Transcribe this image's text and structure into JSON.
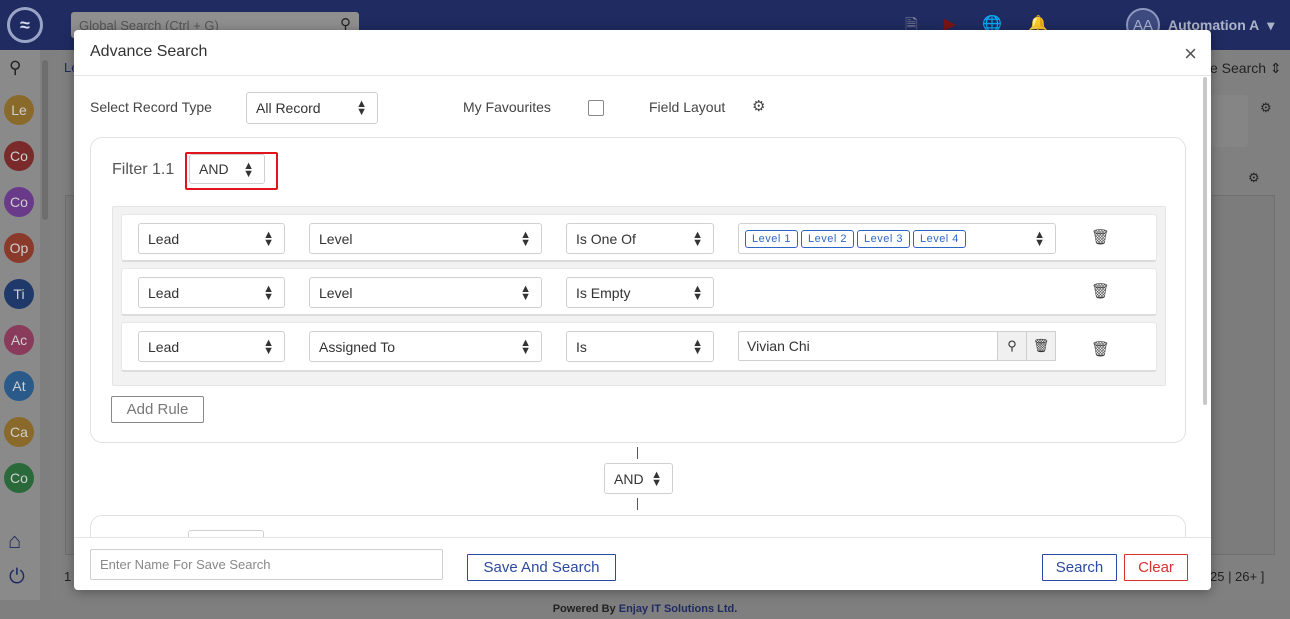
{
  "app": {
    "global_search_placeholder": "Global Search (Ctrl + G)",
    "user_initials": "AA",
    "user_name": "Automation A",
    "breadcrumb": "Le",
    "right_search_label": "e Search",
    "pagination": "25 | 26+ ]",
    "left_number": "1",
    "footer_prefix": "Powered By",
    "footer_brand": "Enjay IT Solutions Ltd."
  },
  "sidebar": {
    "items": [
      {
        "abbr": "Le",
        "color": "#8a6a2a"
      },
      {
        "abbr": "Co",
        "color": "#7a2a2a"
      },
      {
        "abbr": "Co",
        "color": "#6a3a8a"
      },
      {
        "abbr": "Op",
        "color": "#8a3a2a"
      },
      {
        "abbr": "Ti",
        "color": "#1f3a6a"
      },
      {
        "abbr": "Ac",
        "color": "#8a3a5a"
      },
      {
        "abbr": "At",
        "color": "#2a5a8a"
      },
      {
        "abbr": "Ca",
        "color": "#8a6a2a"
      },
      {
        "abbr": "Co",
        "color": "#2a6a3a"
      }
    ]
  },
  "modal": {
    "title": "Advance Search",
    "close_symbol": "×",
    "record_type_label": "Select Record Type",
    "record_type_value": "All Record",
    "favourites_label": "My Favourites",
    "field_layout_label": "Field Layout",
    "filter": {
      "label": "Filter 1.1",
      "operator": "AND",
      "rules": [
        {
          "module": "Lead",
          "field": "Level",
          "condition": "Is One Of",
          "tags": [
            "Level 1",
            "Level 2",
            "Level 3",
            "Level 4"
          ]
        },
        {
          "module": "Lead",
          "field": "Level",
          "condition": "Is Empty"
        },
        {
          "module": "Lead",
          "field": "Assigned To",
          "condition": "Is",
          "value": "Vivian Chi"
        }
      ],
      "add_rule_label": "Add Rule"
    },
    "group_operator": "AND",
    "footer": {
      "save_name_placeholder": "Enter Name For Save Search",
      "save_and_search_label": "Save And Search",
      "search_label": "Search",
      "clear_label": "Clear"
    }
  },
  "colors": {
    "topbar": "#1f2b61",
    "primary": "#2c4a9e",
    "danger": "#d9302c",
    "tag": "#2c67c7",
    "highlight": "#e0151c"
  }
}
